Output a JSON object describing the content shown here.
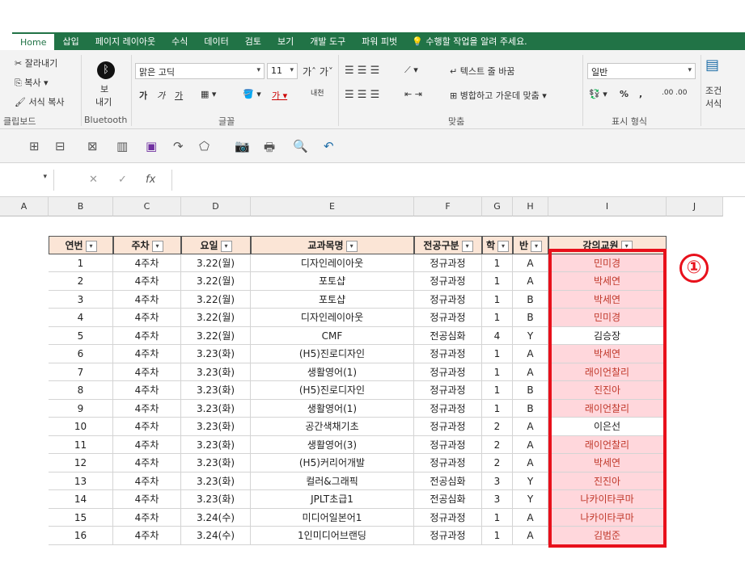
{
  "ribbon": {
    "tabs": [
      "Home",
      "삽입",
      "페이지 레이아웃",
      "수식",
      "데이터",
      "검토",
      "보기",
      "개발 도구",
      "파워 피벗"
    ],
    "tell_me": "수행할 작업을 알려 주세요.",
    "clipboard": {
      "cut": "잘라내기",
      "copy": "복사",
      "format_painter": "서식 복사",
      "group": "클립보드"
    },
    "bluetooth": {
      "label_top": "보",
      "label_bottom": "내기",
      "group": "Bluetooth"
    },
    "font": {
      "name": "맑은 고딕",
      "size": "11",
      "group": "글꼴",
      "bold": "가",
      "italic": "가",
      "underline": "가",
      "phonetic": "내천"
    },
    "alignment": {
      "wrap_text": "텍스트 줄 바꿈",
      "merge_center": "병합하고 가운데 맞춤",
      "group": "맞춤"
    },
    "number": {
      "format": "일반",
      "percent": "%",
      "comma": ",",
      "group": "표시 형식"
    },
    "styles": {
      "cond_top": "조건",
      "cond_bottom": "서식"
    }
  },
  "formula_bar": {
    "fx": "fx",
    "cancel": "✕",
    "enter": "✓"
  },
  "columns": [
    "A",
    "B",
    "C",
    "D",
    "E",
    "F",
    "G",
    "H",
    "I",
    "J"
  ],
  "table": {
    "headers": [
      "연번",
      "주차",
      "요일",
      "교과목명",
      "전공구분",
      "학",
      "반",
      "강의교원"
    ],
    "rows": [
      [
        "1",
        "4주차",
        "3.22(월)",
        "디자인레이아웃",
        "정규과정",
        "1",
        "A",
        "민미경"
      ],
      [
        "2",
        "4주차",
        "3.22(월)",
        "포토샵",
        "정규과정",
        "1",
        "A",
        "박세연"
      ],
      [
        "3",
        "4주차",
        "3.22(월)",
        "포토샵",
        "정규과정",
        "1",
        "B",
        "박세연"
      ],
      [
        "4",
        "4주차",
        "3.22(월)",
        "디자인레이아웃",
        "정규과정",
        "1",
        "B",
        "민미경"
      ],
      [
        "5",
        "4주차",
        "3.22(월)",
        "CMF",
        "전공심화",
        "4",
        "Y",
        "김승장"
      ],
      [
        "6",
        "4주차",
        "3.23(화)",
        "(H5)진로디자인",
        "정규과정",
        "1",
        "A",
        "박세연"
      ],
      [
        "7",
        "4주차",
        "3.23(화)",
        "생활영어(1)",
        "정규과정",
        "1",
        "A",
        "래이언찰리"
      ],
      [
        "8",
        "4주차",
        "3.23(화)",
        "(H5)진로디자인",
        "정규과정",
        "1",
        "B",
        "진진아"
      ],
      [
        "9",
        "4주차",
        "3.23(화)",
        "생활영어(1)",
        "정규과정",
        "1",
        "B",
        "래이언찰리"
      ],
      [
        "10",
        "4주차",
        "3.23(화)",
        "공간색채기초",
        "정규과정",
        "2",
        "A",
        "이은선"
      ],
      [
        "11",
        "4주차",
        "3.23(화)",
        "생활영어(3)",
        "정규과정",
        "2",
        "A",
        "래이언찰리"
      ],
      [
        "12",
        "4주차",
        "3.23(화)",
        "(H5)커리어개발",
        "정규과정",
        "2",
        "A",
        "박세연"
      ],
      [
        "13",
        "4주차",
        "3.23(화)",
        "컬러&그래픽",
        "전공심화",
        "3",
        "Y",
        "진진아"
      ],
      [
        "14",
        "4주차",
        "3.23(화)",
        "JPLT초급1",
        "전공심화",
        "3",
        "Y",
        "나카이타쿠마"
      ],
      [
        "15",
        "4주차",
        "3.24(수)",
        "미디어일본어1",
        "정규과정",
        "1",
        "A",
        "나카이타쿠마"
      ],
      [
        "16",
        "4주차",
        "3.24(수)",
        "1인미디어브랜딩",
        "정규과정",
        "1",
        "A",
        "김범준"
      ]
    ],
    "highlighted_instructor_rows": [
      0,
      1,
      2,
      3,
      5,
      6,
      7,
      8,
      10,
      11,
      12,
      13,
      14,
      15
    ]
  },
  "annotation": {
    "badge": "①"
  },
  "colors": {
    "accent": "#217346",
    "highlight": "#ffd7dc",
    "highlight_text": "#c0392b",
    "annotation_red": "#e8101b",
    "header_fill": "#fbe5d6"
  }
}
